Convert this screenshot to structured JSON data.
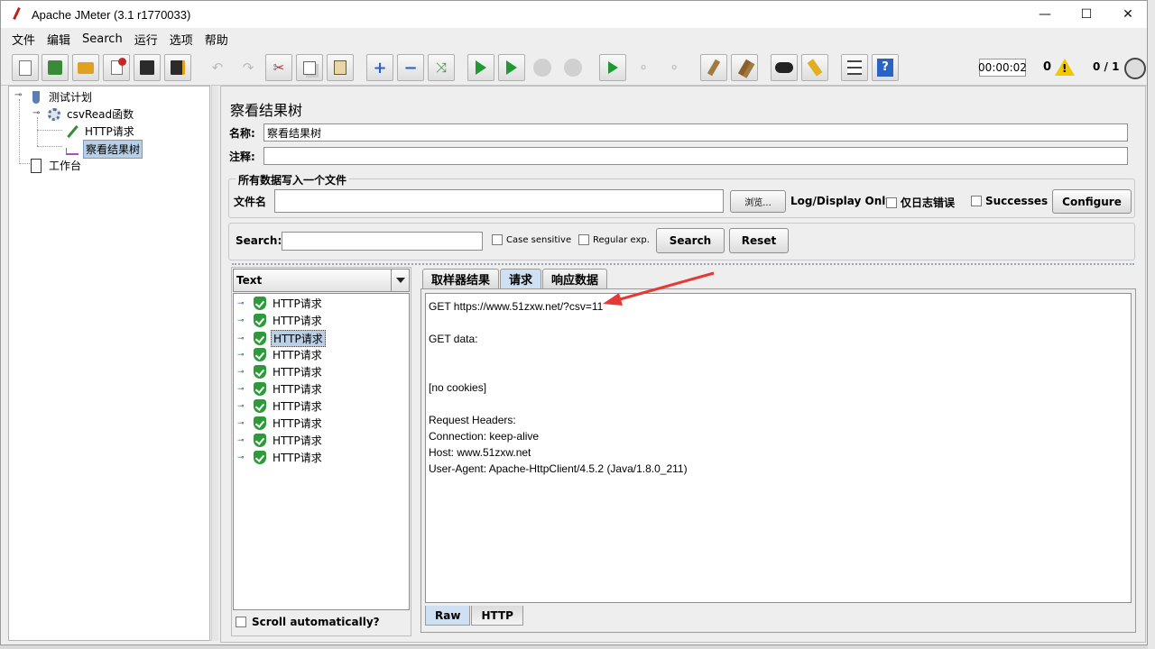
{
  "window": {
    "title": "Apache JMeter (3.1 r1770033)",
    "minimize": "—",
    "maximize": "☐",
    "close": "✕"
  },
  "menu": [
    "文件",
    "编辑",
    "Search",
    "运行",
    "选项",
    "帮助"
  ],
  "toolbar_icons": [
    "new-icon",
    "templates-icon",
    "open-icon",
    "close-file-icon",
    "save-icon",
    "save-as-icon",
    "undo-icon",
    "redo-icon",
    "cut-icon",
    "copy-icon",
    "paste-icon",
    "expand-icon",
    "collapse-icon",
    "toggle-icon",
    "start-icon",
    "start-no-pause-icon",
    "stop-icon",
    "shutdown-icon",
    "remote-start-icon",
    "remote-stop-icon",
    "remote-shutdown-icon",
    "clear-icon",
    "clear-all-icon",
    "search-icon",
    "reset-search-icon",
    "function-helper-icon",
    "help-icon"
  ],
  "status": {
    "timer": "00:00:02",
    "errors": "0",
    "threads": "0 / 1"
  },
  "tree": {
    "plan": "测试计划",
    "csv": "csvRead函数",
    "http": "HTTP请求",
    "listener": "察看结果树",
    "workbench": "工作台"
  },
  "panel": {
    "title": "察看结果树",
    "name_label": "名称:",
    "name_value": "察看结果树",
    "comment_label": "注释:",
    "comment_value": "",
    "file_group": "所有数据写入一个文件",
    "filename_label": "文件名",
    "filename_value": "",
    "browse": "浏览...",
    "log_display": "Log/Display Only:",
    "errors_only": "仅日志错误",
    "successes": "Successes",
    "configure": "Configure",
    "search_label": "Search:",
    "search_value": "",
    "case_sensitive": "Case sensitive",
    "regular_exp": "Regular exp.",
    "search_btn": "Search",
    "reset_btn": "Reset"
  },
  "results": {
    "renderer": "Text",
    "items": [
      "HTTP请求",
      "HTTP请求",
      "HTTP请求",
      "HTTP请求",
      "HTTP请求",
      "HTTP请求",
      "HTTP请求",
      "HTTP请求",
      "HTTP请求",
      "HTTP请求"
    ],
    "selected_index": 2,
    "scroll_auto": "Scroll automatically?"
  },
  "tabs": [
    "取样器结果",
    "请求",
    "响应数据"
  ],
  "active_tab": 1,
  "request_lines": [
    "GET https://www.51zxw.net/?csv=11",
    "",
    "GET data:",
    "",
    "",
    "[no cookies]",
    "",
    "Request Headers:",
    "Connection: keep-alive",
    "Host: www.51zxw.net",
    "User-Agent: Apache-HttpClient/4.5.2 (Java/1.8.0_211)"
  ],
  "bottom_tabs": [
    "Raw",
    "HTTP"
  ],
  "colors": {
    "selection": "#b8cfe5",
    "arrow": "#e53935",
    "pass_green": "#2e9a3a"
  }
}
